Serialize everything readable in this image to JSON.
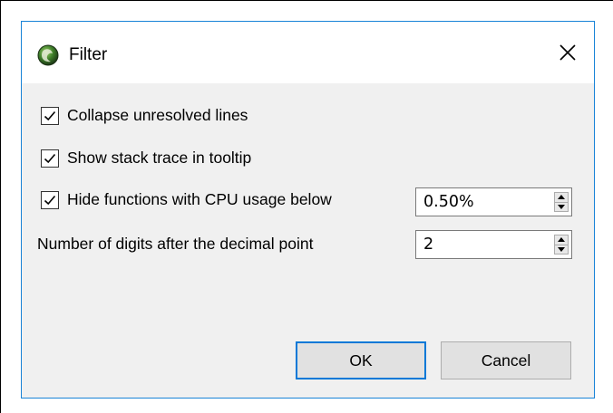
{
  "dialog": {
    "title": "Filter",
    "icon": "app-globe-icon",
    "close_icon": "close-icon",
    "accent_color": "#0078d7"
  },
  "options": {
    "collapse_unresolved": {
      "label": "Collapse unresolved lines",
      "checked": true
    },
    "show_stack_trace": {
      "label": "Show stack trace in tooltip",
      "checked": true
    },
    "hide_functions": {
      "label": "Hide functions with CPU usage below",
      "checked": true,
      "value": "0.50%"
    },
    "decimal_digits": {
      "label": "Number of digits after the decimal point",
      "value": "2"
    }
  },
  "buttons": {
    "ok": "OK",
    "cancel": "Cancel"
  }
}
